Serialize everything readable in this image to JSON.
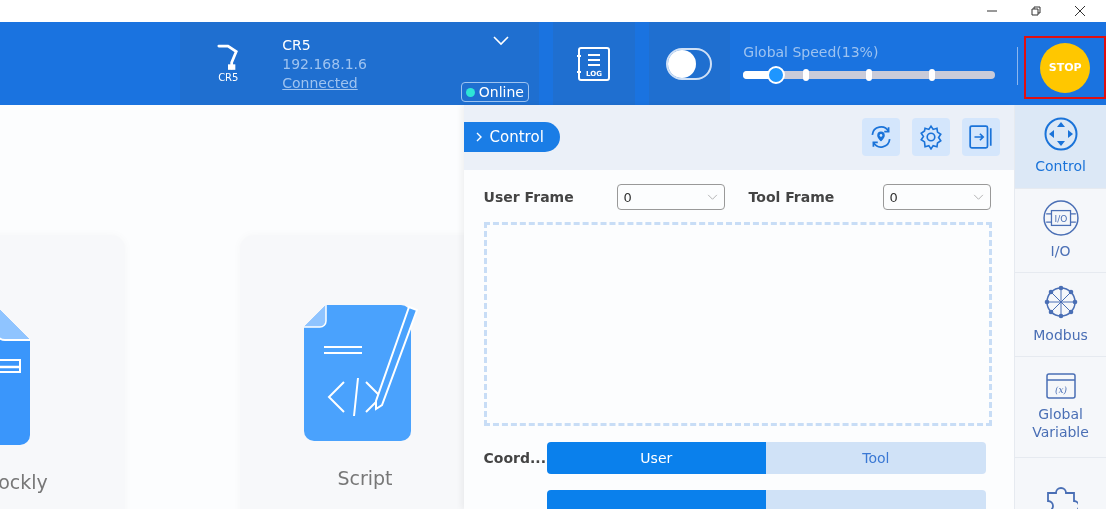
{
  "device": {
    "model_label": "CR5",
    "name": "CR5",
    "ip": "192.168.1.6",
    "link": "Connected",
    "status": "Online"
  },
  "log_button": {
    "label": "LOG"
  },
  "enable_switch": {
    "on": false
  },
  "speed": {
    "label": "Global Speed(13%)",
    "level": 0.13
  },
  "stop_button": {
    "label": "STOP"
  },
  "cards": [
    {
      "kind": "blocks",
      "label": "ockly"
    },
    {
      "kind": "script",
      "label": "Script"
    }
  ],
  "panel": {
    "tab": "Control",
    "user_frame": {
      "label": "User Frame",
      "value": "0"
    },
    "tool_frame": {
      "label": "Tool Frame",
      "value": "0"
    },
    "segments": [
      {
        "label": "Coord...",
        "options": [
          {
            "label": "User",
            "selected": true
          },
          {
            "label": "Tool",
            "selected": false
          }
        ]
      },
      {
        "options": [
          {
            "selected": true
          },
          {
            "selected": false
          }
        ]
      }
    ]
  },
  "sidebar": [
    {
      "kind": "control",
      "label": "Control",
      "selected": true
    },
    {
      "kind": "io",
      "icon_text": "I/O",
      "label": "I/O",
      "selected": false
    },
    {
      "kind": "modbus",
      "label": "Modbus",
      "selected": false
    },
    {
      "kind": "variable",
      "icon_text": "(x)",
      "label": "Global\nVariable",
      "selected": false
    },
    {
      "kind": "plugin",
      "selected": false
    }
  ]
}
